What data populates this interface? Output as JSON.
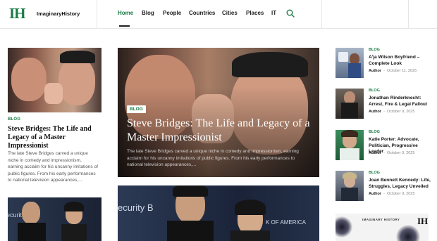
{
  "brand": {
    "mark": "IH",
    "name": "ImaginaryHistory"
  },
  "nav": [
    {
      "label": "Home",
      "active": true
    },
    {
      "label": "Blog"
    },
    {
      "label": "People"
    },
    {
      "label": "Countries"
    },
    {
      "label": "Cities"
    },
    {
      "label": "Places"
    },
    {
      "label": "IT"
    }
  ],
  "search_icon": "search-icon",
  "left_card": {
    "category": "BLOG",
    "title": "Steve Bridges: The Life and Legacy of a Master Impressionist",
    "excerpt": "The late Steve Bridges carved a unique niche in comedy and impressionism, earning acclaim for his uncanny imitations of public figures. From his early performances to national television appearances,..."
  },
  "hero": {
    "category": "BLOG",
    "title": "Steve Bridges: The Life and Legacy of a Master Impressionist",
    "excerpt": "The late Steve Bridges carved a unique niche in comedy and impressionism, earning acclaim for his uncanny imitations of public figures. From his early performances to national television appearances,..."
  },
  "second_image_text": {
    "left": "ecurity B",
    "right": "K OF AMERICA"
  },
  "left_image2_text": "ecurity B",
  "sidebar": [
    {
      "category": "BLOG",
      "title": "A'ja Wilson Boyfriend – Complete Look",
      "author": "Author",
      "date": "October 11, 2025"
    },
    {
      "category": "BLOG",
      "title": "Jonathan Rinderknecht: Arrest, Fire & Legal Fallout",
      "author": "Author",
      "date": "October 9, 2025"
    },
    {
      "category": "BLOG",
      "title": "Katie Porter: Advocate, Politician, Progressive Leader",
      "author": "Author",
      "date": "October 9, 2025"
    },
    {
      "category": "BLOG",
      "title": "Joan Bennett Kennedy: Life, Struggles, Legacy Unveiled",
      "author": "Author",
      "date": "October 9, 2025"
    }
  ],
  "ad": {
    "label": "IMAGINARY HISTORY",
    "mark": "IH"
  },
  "colors": {
    "accent": "#1a7a45",
    "text": "#111111"
  }
}
